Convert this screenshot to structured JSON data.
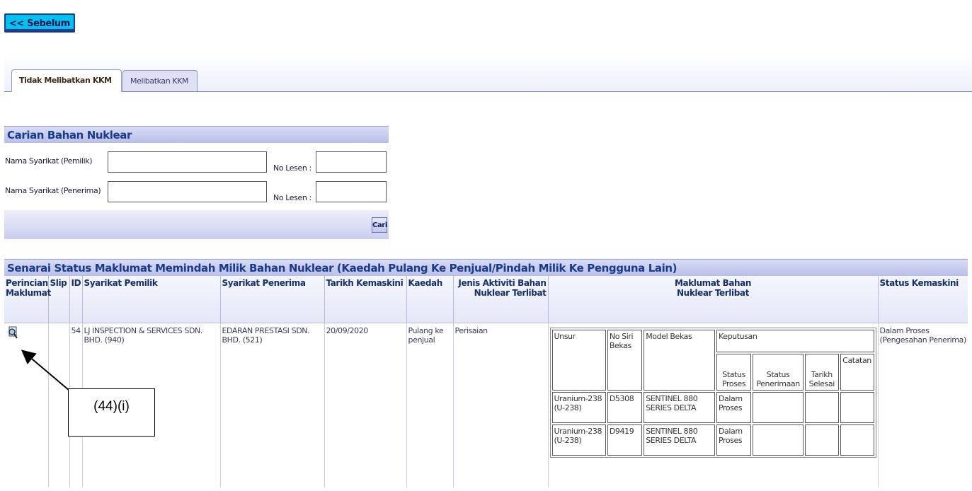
{
  "nav": {
    "back_label": "<< Sebelum"
  },
  "tabs": [
    {
      "label": "Tidak Melibatkan KKM",
      "active": true
    },
    {
      "label": "Melibatkan KKM",
      "active": false
    }
  ],
  "search": {
    "title": "Carian Bahan Nuklear",
    "owner_label": "Nama Syarikat (Pemilik)",
    "owner_value": "",
    "owner_license_label": "No Lesen :",
    "owner_license_value": "",
    "receiver_label": "Nama Syarikat (Penerima)",
    "receiver_value": "",
    "receiver_license_label": "No Lesen :",
    "receiver_license_value": "",
    "button_label": "Cari"
  },
  "results": {
    "title": "Senarai Status Maklumat Memindah Milik Bahan Nuklear (Kaedah Pulang Ke Penjual/Pindah Milik Ke Pengguna Lain)",
    "columns": {
      "detail": "Perincian Maklumat",
      "slip": "Slip",
      "id": "ID",
      "owner": "Syarikat Pemilik",
      "receiver": "Syarikat Penerima",
      "updated": "Tarikh Kemaskini",
      "method": "Kaedah",
      "activity": "Jenis Aktiviti Bahan Nuklear Terlibat",
      "material": "Maklumat Bahan Nuklear Terlibat",
      "status": "Status Kemaskini"
    },
    "row": {
      "id": "54",
      "owner": "LJ INSPECTION & SERVICES SDN. BHD. (940)",
      "receiver": "EDARAN PRESTASI SDN. BHD. (521)",
      "updated": "20/09/2020",
      "method": "Pulang ke penjual",
      "activity": "Perisaian",
      "status": "Dalam Proses (Pengesahan Penerima)"
    },
    "material_table": {
      "headers": {
        "element": "Unsur",
        "serial": "No Siri Bekas",
        "model": "Model Bekas",
        "decision": "Keputusan",
        "process_status": "Status Proses",
        "receive_status": "Status Penerimaan",
        "finish_date": "Tarikh Selesai",
        "note": "Catatan"
      },
      "rows": [
        {
          "element": "Uranium-238 (U-238)",
          "serial": "D5308",
          "model": "SENTINEL 880 SERIES DELTA",
          "status": "Dalam Proses"
        },
        {
          "element": "Uranium-238 (U-238)",
          "serial": "D9419",
          "model": "SENTINEL 880 SERIES DELTA",
          "status": "Dalam Proses"
        }
      ]
    }
  },
  "annotation": {
    "label": "(44)(i)"
  },
  "icons": {
    "detail": "magnifier-document-icon"
  }
}
